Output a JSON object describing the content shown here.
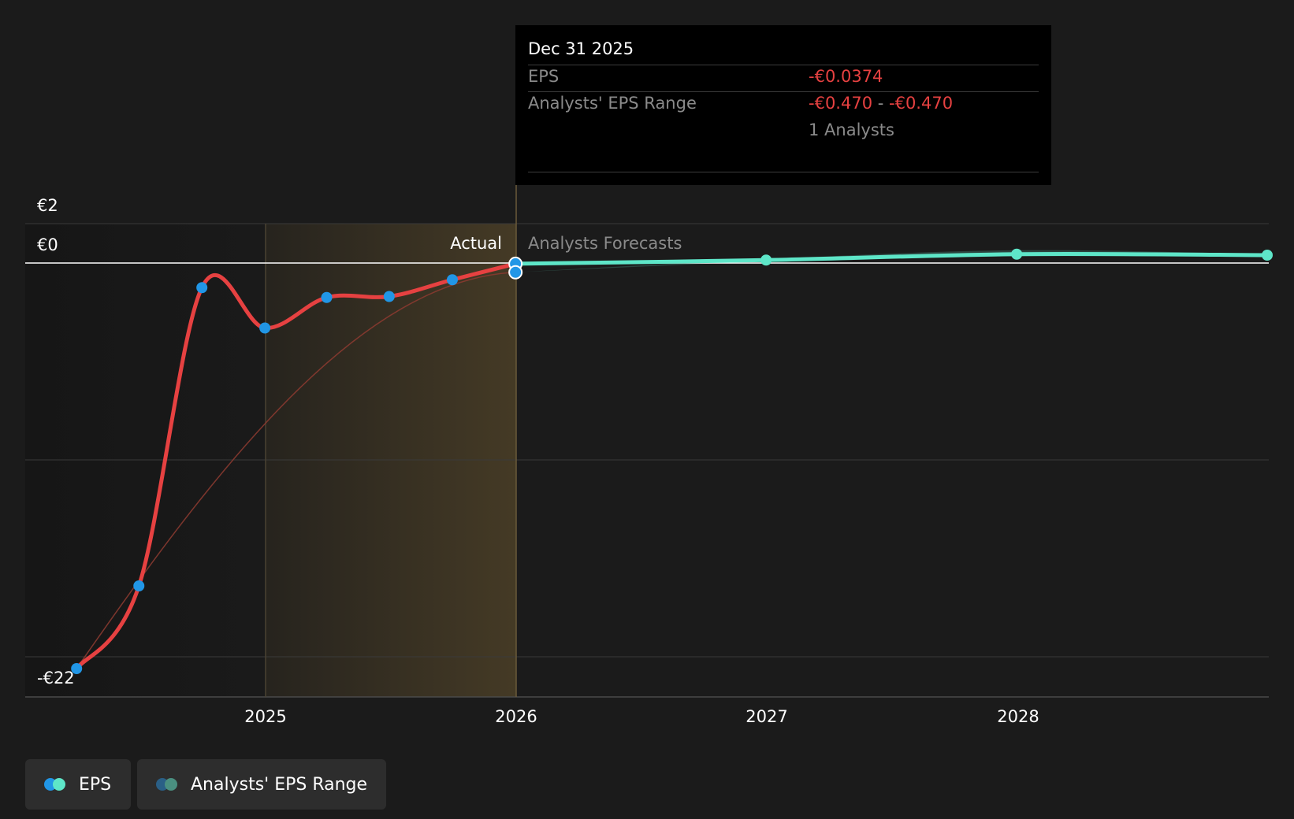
{
  "chart_data": {
    "type": "line",
    "x_axis": {
      "ticks": [
        "2025",
        "2026",
        "2027",
        "2028"
      ],
      "range": [
        "2024-01",
        "2028-12"
      ]
    },
    "y_axis": {
      "ticks": [
        "€2",
        "€0",
        "-€22"
      ],
      "range": [
        -22,
        2
      ]
    },
    "regions": {
      "actual_label": "Actual",
      "forecast_label": "Analysts Forecasts",
      "divider": "2025-12-31"
    },
    "series": [
      {
        "name": "EPS",
        "kind": "actual",
        "color": "#e64141",
        "marker_color": "#2196e6",
        "points": [
          {
            "x": "2024-03-31",
            "y": -20.6
          },
          {
            "x": "2024-06-30",
            "y": -16.4
          },
          {
            "x": "2024-09-30",
            "y": -1.25
          },
          {
            "x": "2024-12-31",
            "y": -3.3
          },
          {
            "x": "2025-03-31",
            "y": -1.75
          },
          {
            "x": "2025-06-30",
            "y": -1.7
          },
          {
            "x": "2025-09-30",
            "y": -0.85
          },
          {
            "x": "2025-12-31",
            "y": -0.0374
          }
        ]
      },
      {
        "name": "EPS",
        "kind": "forecast",
        "color": "#5ee6c8",
        "points": [
          {
            "x": "2025-12-31",
            "y": -0.0374
          },
          {
            "x": "2026-12-31",
            "y": 0.15
          },
          {
            "x": "2027-12-31",
            "y": 0.45
          },
          {
            "x": "2028-12-31",
            "y": 0.4
          }
        ]
      },
      {
        "name": "Analysts' EPS Range",
        "kind": "range",
        "color": "#4a8f80",
        "points": [
          {
            "x": "2025-12-31",
            "low": -0.47,
            "high": -0.47
          },
          {
            "x": "2026-12-31",
            "low": 0.1,
            "high": 0.2
          },
          {
            "x": "2027-12-31",
            "low": 0.35,
            "high": 0.65
          },
          {
            "x": "2028-12-31",
            "low": 0.35,
            "high": 0.45
          }
        ]
      }
    ],
    "trend_line_color": "#8a3a30"
  },
  "tooltip": {
    "date": "Dec 31 2025",
    "eps_label": "EPS",
    "eps_value": "-€0.0374",
    "range_label": "Analysts' EPS Range",
    "range_low": "-€0.470",
    "range_sep": " - ",
    "range_high": "-€0.470",
    "analysts": "1 Analysts"
  },
  "legend": {
    "items": [
      {
        "label": "EPS",
        "color_a": "#2196e6",
        "color_b": "#5ee6c8"
      },
      {
        "label": "Analysts' EPS Range",
        "color_a": "#2a5f86",
        "color_b": "#4a8f80"
      }
    ]
  },
  "colors": {
    "background": "#1b1b1b",
    "highlight": "#d8a84a"
  }
}
